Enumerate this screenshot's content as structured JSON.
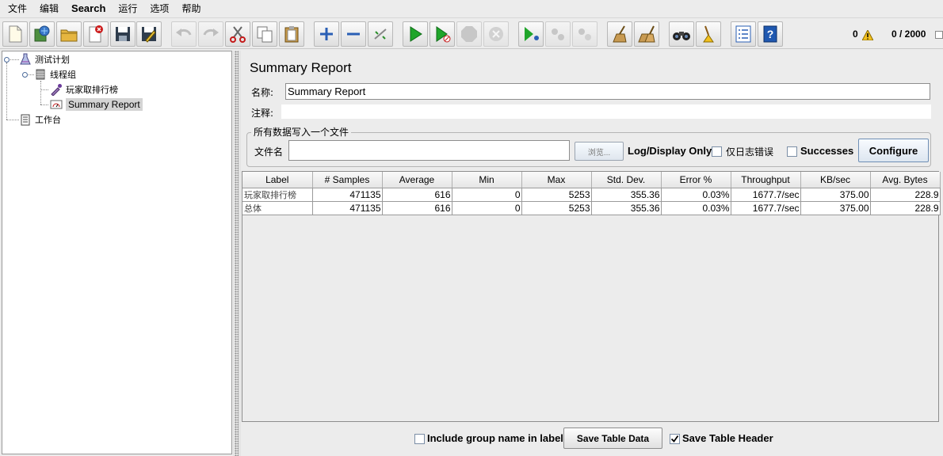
{
  "menu": [
    "文件",
    "编辑",
    "Search",
    "运行",
    "选项",
    "帮助"
  ],
  "status": {
    "error_count": "0",
    "threads": "0 / 2000"
  },
  "tree": {
    "test_plan": "测试计划",
    "thread_group": "线程组",
    "sampler": "玩家取排行榜",
    "summary_report": "Summary Report",
    "workbench": "工作台"
  },
  "panel": {
    "title": "Summary Report",
    "name_label": "名称:",
    "name_value": "Summary Report",
    "comment_label": "注释:",
    "file_group_title": "所有数据写入一个文件",
    "filename_label": "文件名",
    "filename_value": "",
    "browse_label": "浏览...",
    "log_display_label": "Log/Display Only:",
    "errors_only_label": "仅日志错误",
    "errors_only_checked": false,
    "successes_label": "Successes",
    "successes_checked": false,
    "configure_label": "Configure"
  },
  "table": {
    "columns": [
      "Label",
      "# Samples",
      "Average",
      "Min",
      "Max",
      "Std. Dev.",
      "Error %",
      "Throughput",
      "KB/sec",
      "Avg. Bytes"
    ],
    "rows": [
      [
        "玩家取排行榜",
        "471135",
        "616",
        "0",
        "5253",
        "355.36",
        "0.03%",
        "1677.7/sec",
        "375.00",
        "228.9"
      ],
      [
        "总体",
        "471135",
        "616",
        "0",
        "5253",
        "355.36",
        "0.03%",
        "1677.7/sec",
        "375.00",
        "228.9"
      ]
    ]
  },
  "bottom": {
    "include_group_label": "Include group name in label?",
    "include_group_checked": false,
    "save_table_data_label": "Save Table Data",
    "save_table_header_label": "Save Table Header",
    "save_table_header_checked": true
  }
}
